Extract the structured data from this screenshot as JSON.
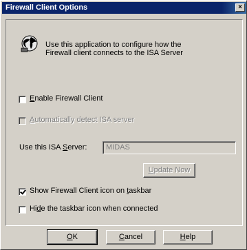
{
  "window": {
    "title": "Firewall Client Options",
    "close_glyph": "×"
  },
  "intro": {
    "icon": "firewall-client-globe-icon",
    "line1": "Use this application to configure how the",
    "line2": "Firewall client connects to the ISA Server"
  },
  "options": {
    "enable_client": {
      "pre": "",
      "key": "E",
      "post": "nable Firewall Client",
      "checked": false,
      "enabled": true
    },
    "auto_detect": {
      "pre": "",
      "key": "A",
      "post": "utomatically detect ISA server",
      "checked": false,
      "enabled": false
    },
    "isa_server_label": {
      "pre": "Use this ISA ",
      "key": "S",
      "post": "erver:"
    },
    "isa_server_value": "MIDAS",
    "update_now": {
      "pre": "",
      "key": "U",
      "post": "pdate Now",
      "enabled": false
    },
    "show_icon": {
      "pre": "Show Firewall Client icon on ",
      "key": "t",
      "post": "askbar",
      "checked": true,
      "enabled": true
    },
    "hide_icon": {
      "pre": "Hi",
      "key": "d",
      "post": "e the taskbar icon when connected",
      "checked": false,
      "enabled": true
    }
  },
  "buttons": {
    "ok": {
      "pre": "",
      "key": "O",
      "post": "K"
    },
    "cancel": {
      "pre": "",
      "key": "C",
      "post": "ancel"
    },
    "help": {
      "pre": "",
      "key": "H",
      "post": "elp"
    }
  }
}
